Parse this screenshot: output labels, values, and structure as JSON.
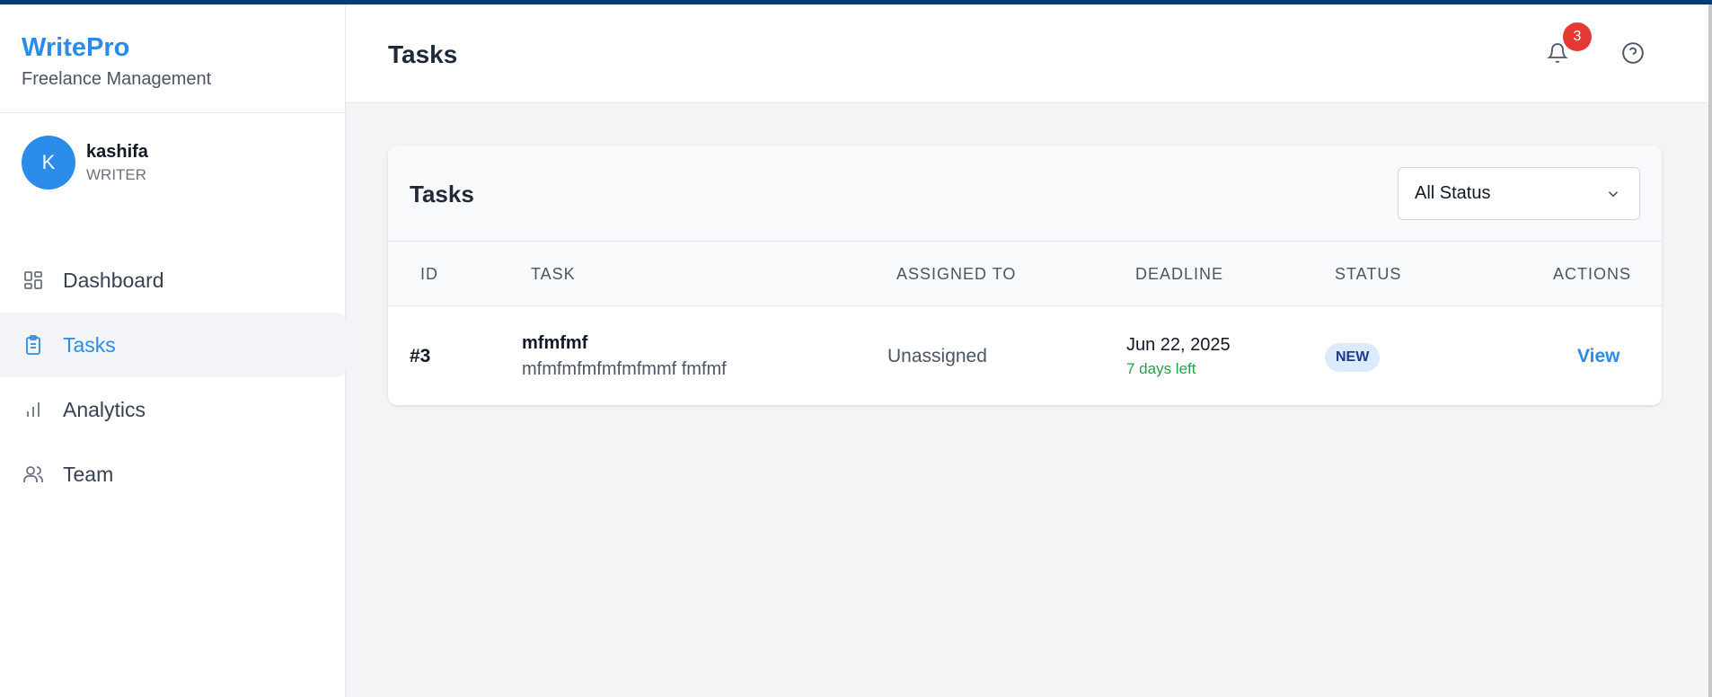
{
  "brand": {
    "title": "WritePro",
    "subtitle": "Freelance Management"
  },
  "user": {
    "initial": "K",
    "name": "kashifa",
    "role": "WRITER"
  },
  "nav": [
    {
      "label": "Dashboard",
      "icon": "dashboard-icon",
      "active": false
    },
    {
      "label": "Tasks",
      "icon": "clipboard-icon",
      "active": true
    },
    {
      "label": "Analytics",
      "icon": "bar-chart-icon",
      "active": false
    },
    {
      "label": "Team",
      "icon": "users-icon",
      "active": false
    }
  ],
  "header": {
    "title": "Tasks",
    "notification_count": "3"
  },
  "tasks_card": {
    "title": "Tasks",
    "filter": {
      "selected": "All Status"
    },
    "columns": [
      "ID",
      "TASK",
      "ASSIGNED TO",
      "DEADLINE",
      "STATUS",
      "ACTIONS"
    ],
    "rows": [
      {
        "id": "#3",
        "task_title": "mfmfmf",
        "task_desc": "mfmfmfmfmfmfmmf fmfmf",
        "assigned_to": "Unassigned",
        "deadline": "Jun 22, 2025",
        "time_left": "7 days left",
        "status": "NEW",
        "action": "View"
      }
    ]
  },
  "colors": {
    "accent": "#2a8ce8",
    "top_strip": "#0b3a75",
    "badge": "#e53935",
    "status_new_bg": "#dbeafe",
    "time_left": "#22a34a"
  }
}
